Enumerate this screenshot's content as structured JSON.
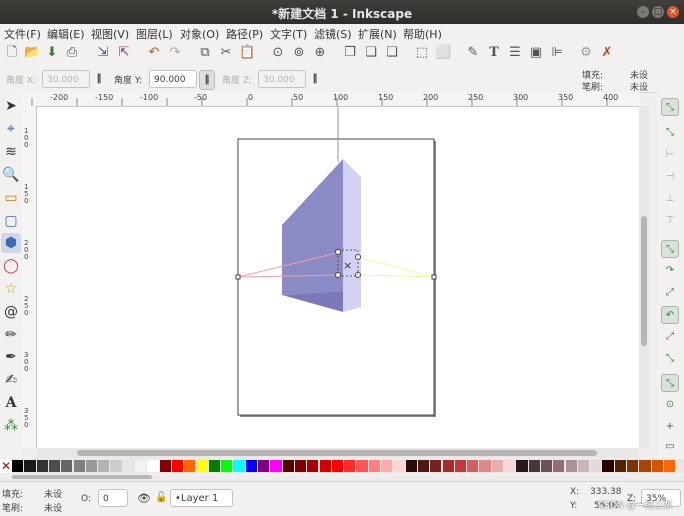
{
  "window": {
    "title": "*新建文档 1 - Inkscape"
  },
  "menu": [
    "文件(F)",
    "编辑(E)",
    "视图(V)",
    "图层(L)",
    "对象(O)",
    "路径(P)",
    "文字(T)",
    "滤镜(S)",
    "扩展(N)",
    "帮助(H)"
  ],
  "controls": {
    "angle_x_label": "角度 X:",
    "angle_x_value": "30.000",
    "angle_y_label": "角度 Y:",
    "angle_y_value": "90.000",
    "angle_z_label": "角度 Z:",
    "angle_z_value": "30.000",
    "fill_label": "填充:",
    "fill_value": "未设",
    "stroke_label": "笔刷:",
    "stroke_value": "未设"
  },
  "ruler_top": [
    "-200",
    "-150",
    "-100",
    "-50",
    "0",
    "50",
    "100",
    "150",
    "200",
    "250",
    "300",
    "350",
    "400"
  ],
  "ruler_left": [
    "1 0 0",
    "1 5 0",
    "2 0 0",
    "2 5 0",
    "3 0 0",
    "3 5 0"
  ],
  "status": {
    "fill_label": "填充:",
    "fill_value": "未设",
    "stroke_label": "笔刷:",
    "stroke_value": "未设",
    "opacity_label": "O:",
    "opacity_value": "0",
    "layer": "•Layer 1",
    "x_label": "X:",
    "x_value": "333.38",
    "y_label": "Y:",
    "y_value": "55.00",
    "z_label": "Z:",
    "zoom": "35%",
    "watermark": "CSDN @一统江湖"
  },
  "palette_colors": [
    "#000000",
    "#1a1a1a",
    "#333333",
    "#4d4d4d",
    "#666666",
    "#808080",
    "#999999",
    "#b3b3b3",
    "#cccccc",
    "#e6e6e6",
    "#f2f2f2",
    "#ffffff",
    "#800000",
    "#ff0000",
    "#ff6600",
    "#ffff00",
    "#008000",
    "#00ff00",
    "#00ffff",
    "#0000ff",
    "#800080",
    "#ff00ff",
    "#550000",
    "#800000",
    "#aa0000",
    "#d40000",
    "#ff0000",
    "#ff2a2a",
    "#ff5555",
    "#ff8080",
    "#ffaaaa",
    "#ffd5d5",
    "#280b0b",
    "#501616",
    "#782121",
    "#a02c2c",
    "#c83737",
    "#d35f5f",
    "#de8787",
    "#e9afaf",
    "#f4d7d7",
    "#241c1c",
    "#483737",
    "#6c5353",
    "#916f6f",
    "#ac9393",
    "#c8b7b7",
    "#e3dbdb",
    "#280000",
    "#552200",
    "#803300",
    "#aa4400",
    "#d45500",
    "#ff6600"
  ]
}
